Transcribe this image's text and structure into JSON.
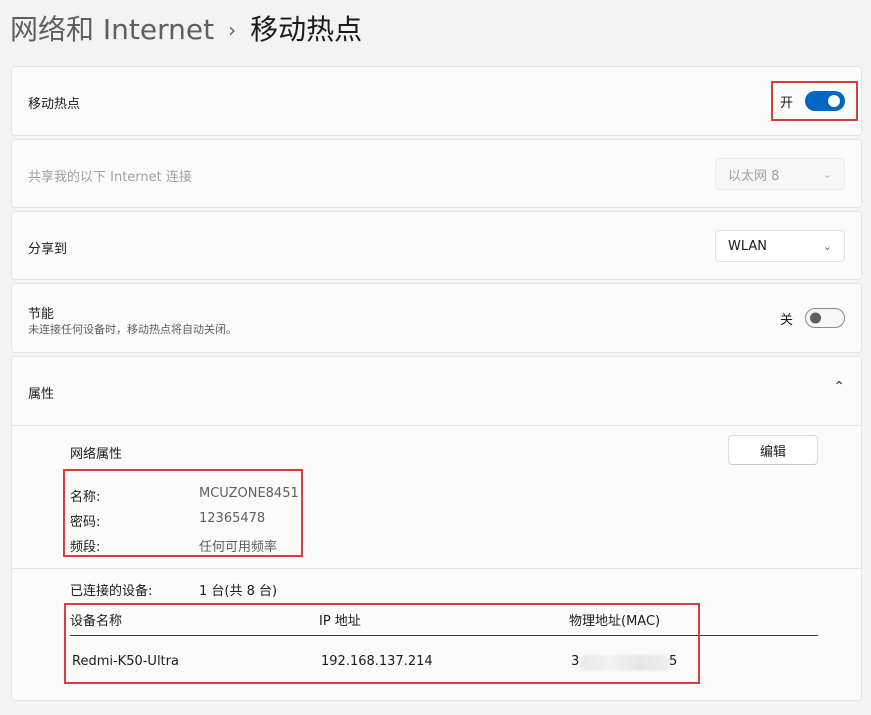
{
  "breadcrumb": {
    "parent": "网络和 Internet",
    "separator": "›",
    "current": "移动热点"
  },
  "hotspot": {
    "label": "移动热点",
    "state_text": "开",
    "enabled": true
  },
  "share_from": {
    "label": "共享我的以下 Internet 连接",
    "value": "以太网 8",
    "disabled": true
  },
  "share_over": {
    "label": "分享到",
    "value": "WLAN"
  },
  "power_saving": {
    "label": "节能",
    "description": "未连接任何设备时，移动热点将自动关闭。",
    "state_text": "关",
    "enabled": false
  },
  "properties": {
    "label": "属性",
    "expanded": true,
    "network_props_title": "网络属性",
    "edit_label": "编辑",
    "items": [
      {
        "key": "名称:",
        "value": "MCUZONE8451"
      },
      {
        "key": "密码:",
        "value": "12365478"
      },
      {
        "key": "频段:",
        "value": "任何可用频率"
      }
    ],
    "connected_label": "已连接的设备:",
    "connected_value": "1 台(共 8 台)",
    "table": {
      "headers": [
        "设备名称",
        "IP 地址",
        "物理地址(MAC)"
      ],
      "rows": [
        {
          "name": "Redmi-K50-Ultra",
          "ip": "192.168.137.214",
          "mac_start": "3",
          "mac_end": "5"
        }
      ]
    }
  },
  "colors": {
    "accent": "#0067c0",
    "highlight": "#d43f3f"
  }
}
